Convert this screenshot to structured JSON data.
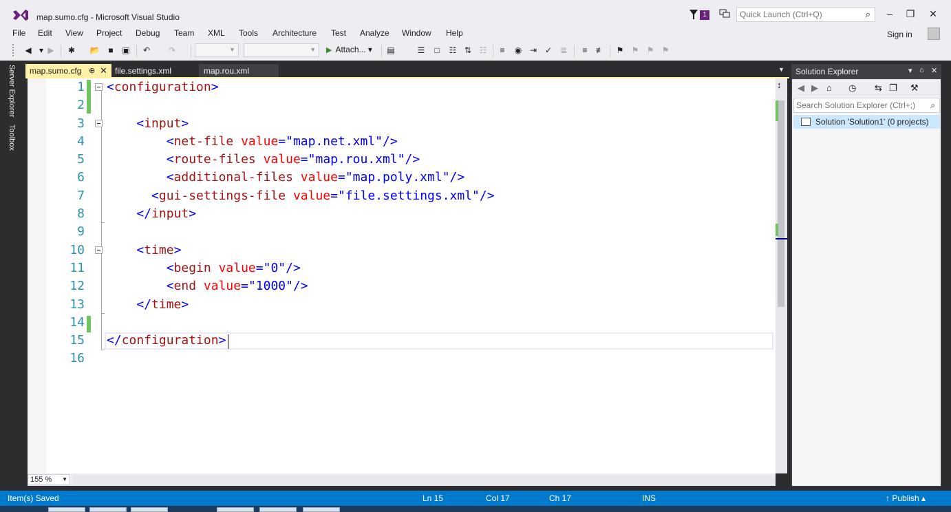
{
  "window": {
    "title": "map.sumo.cfg - Microsoft Visual Studio",
    "notification_count": "1",
    "quick_launch_placeholder": "Quick Launch (Ctrl+Q)",
    "sign_in": "Sign in"
  },
  "menu": {
    "items": [
      "File",
      "Edit",
      "View",
      "Project",
      "Debug",
      "Team",
      "XML",
      "Tools",
      "Architecture",
      "Test",
      "Analyze",
      "Window",
      "Help"
    ]
  },
  "toolbar": {
    "attach_label": "Attach..."
  },
  "left_tools": {
    "server_explorer": "Server Explorer",
    "toolbox": "Toolbox"
  },
  "tabs": [
    {
      "label": "map.sumo.cfg",
      "active": true
    },
    {
      "label": "file.settings.xml",
      "active": false
    },
    {
      "label": "map.rou.xml",
      "active": false
    }
  ],
  "editor": {
    "line_numbers": [
      "1",
      "2",
      "3",
      "4",
      "5",
      "6",
      "7",
      "8",
      "9",
      "10",
      "11",
      "12",
      "13",
      "14",
      "15",
      "16"
    ],
    "lines": [
      {
        "indent": "",
        "open": "<",
        "tag": "configuration",
        "parts": [],
        "close": ">"
      },
      {
        "indent": "",
        "open": "",
        "tag": "",
        "parts": [],
        "close": ""
      },
      {
        "indent": "    ",
        "open": "<",
        "tag": "input",
        "parts": [],
        "close": ">"
      },
      {
        "indent": "        ",
        "open": "<",
        "tag": "net-file",
        "parts": [
          {
            "attr": "value",
            "val": "\"map.net.xml\""
          }
        ],
        "close": "/>"
      },
      {
        "indent": "        ",
        "open": "<",
        "tag": "route-files",
        "parts": [
          {
            "attr": "value",
            "val": "\"map.rou.xml\""
          }
        ],
        "close": "/>"
      },
      {
        "indent": "        ",
        "open": "<",
        "tag": "additional-files",
        "parts": [
          {
            "attr": "value",
            "val": "\"map.poly.xml\""
          }
        ],
        "close": "/>"
      },
      {
        "indent": "      ",
        "open": "<",
        "tag": "gui-settings-file",
        "parts": [
          {
            "attr": "value",
            "val": "\"file.settings.xml\""
          }
        ],
        "close": "/>"
      },
      {
        "indent": "    ",
        "open": "</",
        "tag": "input",
        "parts": [],
        "close": ">"
      },
      {
        "indent": "",
        "open": "",
        "tag": "",
        "parts": [],
        "close": ""
      },
      {
        "indent": "    ",
        "open": "<",
        "tag": "time",
        "parts": [],
        "close": ">"
      },
      {
        "indent": "        ",
        "open": "<",
        "tag": "begin",
        "parts": [
          {
            "attr": "value",
            "val": "\"0\""
          }
        ],
        "close": "/>"
      },
      {
        "indent": "        ",
        "open": "<",
        "tag": "end",
        "parts": [
          {
            "attr": "value",
            "val": "\"1000\""
          }
        ],
        "close": "/>"
      },
      {
        "indent": "    ",
        "open": "</",
        "tag": "time",
        "parts": [],
        "close": ">"
      },
      {
        "indent": "",
        "open": "",
        "tag": "",
        "parts": [],
        "close": ""
      },
      {
        "indent": "",
        "open": "</",
        "tag": "configuration",
        "parts": [],
        "close": ">"
      },
      {
        "indent": "",
        "open": "",
        "tag": "",
        "parts": [],
        "close": ""
      }
    ],
    "zoom": "155 %"
  },
  "solution_explorer": {
    "title": "Solution Explorer",
    "search_placeholder": "Search Solution Explorer (Ctrl+;)",
    "root_item": "Solution 'Solution1' (0 projects)"
  },
  "status": {
    "message": "Item(s) Saved",
    "line": "Ln 15",
    "col": "Col 17",
    "ch": "Ch 17",
    "mode": "INS",
    "publish": "Publish"
  },
  "colors": {
    "accent": "#007acc",
    "tag": "#a31515",
    "attr": "#ff0000",
    "value": "#0000ff",
    "line_number": "#2b91af",
    "change_marker": "#6ec45e",
    "active_tab": "#fff1a8"
  }
}
